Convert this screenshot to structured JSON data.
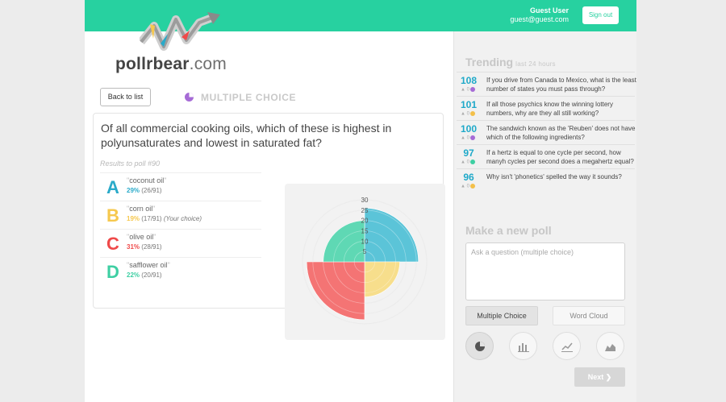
{
  "header": {
    "user_name": "Guest User",
    "user_email": "guest@guest.com",
    "sign_out_label": "Sign out",
    "brand_color": "#27d1a0"
  },
  "logo": {
    "prefix": "pollrbear",
    "suffix": ".com"
  },
  "poll": {
    "back_label": "Back to list",
    "type_label": "MULTIPLE CHOICE",
    "question": "Of all commercial cooking oils, which of these is highest in polyunsaturates and lowest in saturated fat?",
    "results_title": "Results to poll #90",
    "answers": [
      {
        "letter": "A",
        "name": "coconut oil",
        "pct": "29%",
        "count": "(26/91)",
        "note": "",
        "color": "#2aaac9"
      },
      {
        "letter": "B",
        "name": "corn oil",
        "pct": "19%",
        "count": "(17/91)",
        "note": "(Your choice)",
        "color": "#f6c84e"
      },
      {
        "letter": "C",
        "name": "olive oil",
        "pct": "31%",
        "count": "(28/91)",
        "note": "",
        "color": "#ef4a4a"
      },
      {
        "letter": "D",
        "name": "safflower oil",
        "pct": "22%",
        "count": "(20/91)",
        "note": "",
        "color": "#3ecfa3"
      }
    ]
  },
  "chart_data": {
    "type": "polar-area",
    "categories": [
      "coconut oil",
      "corn oil",
      "olive oil",
      "safflower oil"
    ],
    "values": [
      26,
      17,
      28,
      20
    ],
    "colors": [
      "#5bc4d8",
      "#f7de8c",
      "#f47474",
      "#5fd8b4"
    ],
    "ticks": [
      30,
      25,
      20,
      15,
      10,
      5
    ],
    "rmax": 30,
    "grid": true
  },
  "trending": {
    "title": "Trending",
    "subtitle": "last 24 hours",
    "items": [
      {
        "votes": "108",
        "count": "0",
        "icon_color": "#a66bd6",
        "text": "If you drive from Canada to Mexico, what is the least number of states you must pass through?"
      },
      {
        "votes": "101",
        "count": "0",
        "icon_color": "#f3c04a",
        "text": "If all those psychics know the winning lottery numbers, why are they all still working?"
      },
      {
        "votes": "100",
        "count": "0",
        "icon_color": "#a66bd6",
        "text": "The sandwich known as the 'Reuben' does not have which of the following ingredients?"
      },
      {
        "votes": "97",
        "count": "0",
        "icon_color": "#3ecfa3",
        "text": "If a hertz is equal to one cycle per second, how manyh cycles per second does a megahertz equal?"
      },
      {
        "votes": "96",
        "count": "0",
        "icon_color": "#f3c04a",
        "text": "Why isn't 'phonetics' spelled the way it sounds?"
      }
    ]
  },
  "new_poll": {
    "title": "Make a new poll",
    "placeholder": "Ask a question (multiple choice)",
    "type_mc_label": "Multiple Choice",
    "type_wc_label": "Word Cloud",
    "next_label": "Next"
  }
}
